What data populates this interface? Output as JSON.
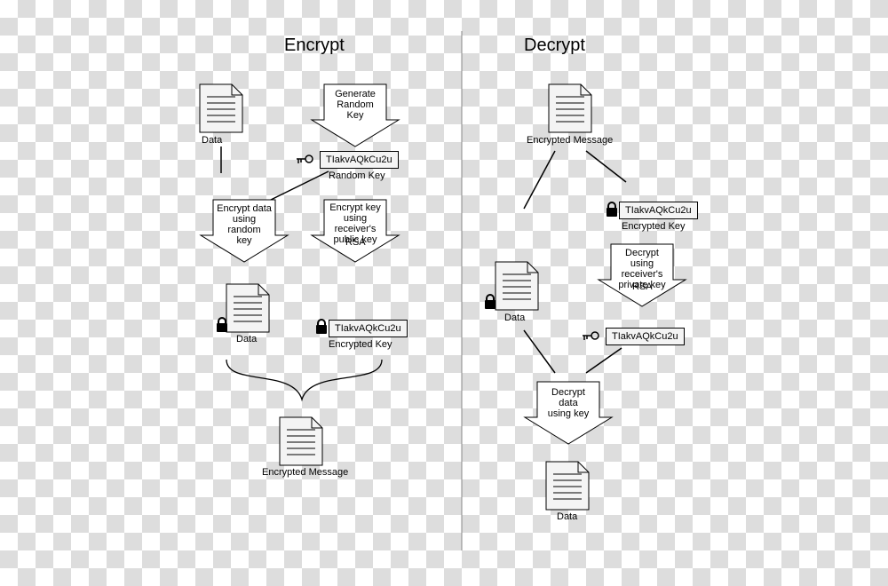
{
  "encrypt": {
    "heading": "Encrypt",
    "data_label": "Data",
    "gen_key_line1": "Generate",
    "gen_key_line2": "Random",
    "gen_key_line3": "Key",
    "random_key_value": "TIakvAQkCu2u",
    "random_key_label": "Random Key",
    "encrypt_data_line1": "Encrypt data",
    "encrypt_data_line2": "using random",
    "encrypt_data_line3": "key",
    "encrypt_key_line1": "Encrypt key",
    "encrypt_key_line2": "using receiver's",
    "encrypt_key_line3": "public key",
    "rsa": "RSA",
    "enc_data_label": "Data",
    "enc_key_value": "TIakvAQkCu2u",
    "enc_key_label": "Encrypted Key",
    "enc_msg_label": "Encrypted Message"
  },
  "decrypt": {
    "heading": "Decrypt",
    "enc_msg_label": "Encrypted Message",
    "enc_key_value": "TIakvAQkCu2u",
    "enc_key_label": "Encrypted Key",
    "enc_data_label": "Data",
    "decrypt_key_line1": "Decrypt using",
    "decrypt_key_line2": "receiver's",
    "decrypt_key_line3": "private key",
    "rsa": "RSA",
    "random_key_value": "TIakvAQkCu2u",
    "decrypt_data_line1": "Decrypt data",
    "decrypt_data_line2": "using key",
    "data_label": "Data"
  }
}
